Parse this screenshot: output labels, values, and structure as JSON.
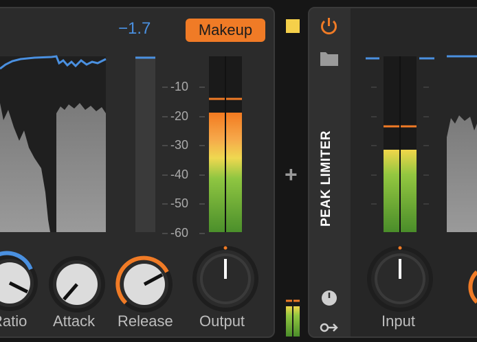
{
  "compressor": {
    "gain_reduction": "−1.7",
    "makeup_button": "Makeup",
    "scale": [
      "-10",
      "-20",
      "-30",
      "-40",
      "-50",
      "-60"
    ],
    "knobs": [
      {
        "label": "Ratio"
      },
      {
        "label": "Attack"
      },
      {
        "label": "Release"
      },
      {
        "label": "Output"
      }
    ]
  },
  "device_strip": {
    "title": "PEAK LIMITER",
    "icons": [
      "power-icon",
      "folder-icon",
      "clock-icon",
      "routing-icon"
    ]
  },
  "limiter": {
    "knobs": [
      {
        "label": "Input"
      }
    ]
  },
  "colors": {
    "accent_orange": "#f07b26",
    "accent_blue": "#4a90e0",
    "meter_green": "#7dc242",
    "meter_yellow": "#f0d040"
  }
}
